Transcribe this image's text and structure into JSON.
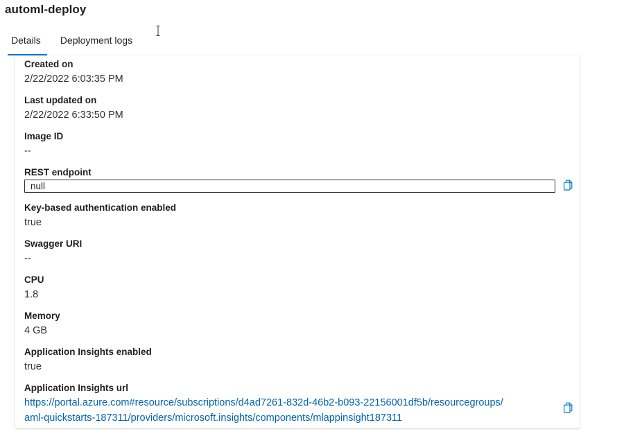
{
  "page": {
    "title": "automl-deploy"
  },
  "tabs": [
    {
      "label": "Details",
      "active": true
    },
    {
      "label": "Deployment logs",
      "active": false
    }
  ],
  "details": {
    "created_on": {
      "label": "Created on",
      "value": "2/22/2022 6:03:35 PM"
    },
    "last_updated_on": {
      "label": "Last updated on",
      "value": "2/22/2022 6:33:50 PM"
    },
    "image_id": {
      "label": "Image ID",
      "value": "--"
    },
    "rest_endpoint": {
      "label": "REST endpoint",
      "value": "null"
    },
    "key_auth": {
      "label": "Key-based authentication enabled",
      "value": "true"
    },
    "swagger_uri": {
      "label": "Swagger URI",
      "value": "--"
    },
    "cpu": {
      "label": "CPU",
      "value": "1.8"
    },
    "memory": {
      "label": "Memory",
      "value": "4 GB"
    },
    "app_insights_enabled": {
      "label": "Application Insights enabled",
      "value": "true"
    },
    "app_insights_url": {
      "label": "Application Insights url",
      "line1": "https://portal.azure.com#resource/subscriptions/d4ad7261-832d-46b2-b093-22156001df5b/resourcegroups/",
      "line2": "aml-quickstarts-187311/providers/microsoft.insights/components/mlappinsight187311"
    }
  },
  "icons": {
    "copy_endpoint": "copy-icon",
    "copy_url": "copy-icon",
    "text_cursor": "i-beam-cursor-icon"
  },
  "colors": {
    "accent": "#0078d4",
    "link": "#0063b1",
    "text": "#201f1e"
  }
}
